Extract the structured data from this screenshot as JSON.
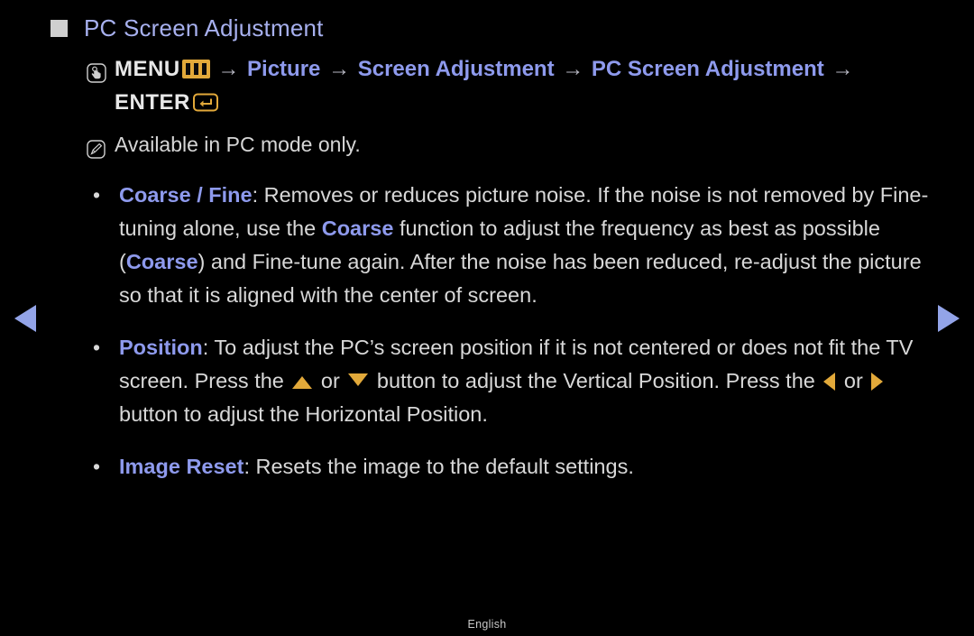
{
  "page": {
    "background_color": "#000000",
    "accent_gold": "#e2a93a",
    "accent_blue": "#8e9aed",
    "body_text_color": "#d8d8d8"
  },
  "header": {
    "bullet_icon": "filled-square-icon",
    "title": "PC Screen Adjustment"
  },
  "menu_path": {
    "icon": "hand-press-icon",
    "menu_label": "MENU",
    "menu_glyph": "menu-bars-icon",
    "sep": "→",
    "steps": [
      "Picture",
      "Screen Adjustment",
      "PC Screen Adjustment"
    ],
    "enter_label": "ENTER",
    "enter_glyph": "enter-return-icon"
  },
  "note": {
    "icon": "note-pencil-icon",
    "text": "Available in PC mode only."
  },
  "bullets": [
    {
      "marker": "•",
      "keyword": "Coarse / Fine",
      "lead_punct": ":",
      "text_part_1": " Removes or reduces picture noise. If the noise is not removed by Fine-tuning alone, use the ",
      "inline_keyword_1": "Coarse",
      "text_part_2": " function to adjust the frequency as best as possible (",
      "inline_keyword_2": "Coarse",
      "text_part_3": ") and Fine-tune again. After the noise has been reduced, re-adjust the picture so that it is aligned with the center of screen."
    },
    {
      "marker": "•",
      "keyword": "Position",
      "lead_punct": ":",
      "text_part_1": " To adjust the PC’s screen position if it is not centered or does not fit the TV screen. Press the ",
      "icon_up": "arrow-up-icon",
      "text_part_2": " or ",
      "icon_down": "arrow-down-icon",
      "text_part_3": " button to adjust the Vertical Position. Press the ",
      "icon_left": "arrow-left-icon",
      "text_part_4": " or ",
      "icon_right": "arrow-right-icon",
      "text_part_5": " button to adjust the Horizontal Position."
    },
    {
      "marker": "•",
      "keyword": "Image Reset",
      "lead_punct": ":",
      "text_part_1": " Resets the image to the default settings."
    }
  ],
  "navigation": {
    "prev_icon": "triangle-left-icon",
    "next_icon": "triangle-right-icon"
  },
  "footer": {
    "language": "English"
  }
}
